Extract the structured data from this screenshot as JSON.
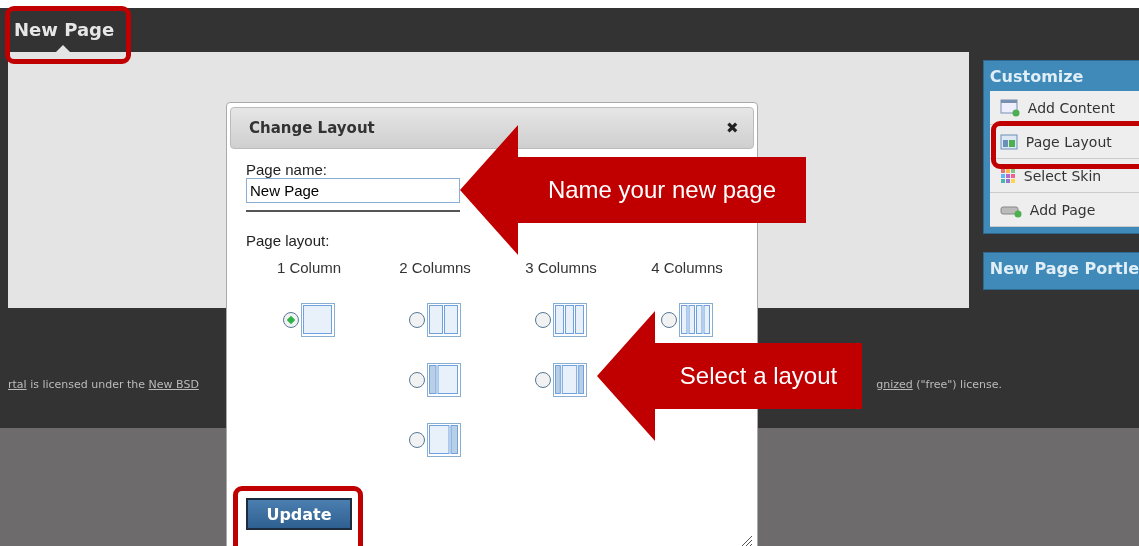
{
  "top_tab": {
    "label": "New Page",
    "selected": true
  },
  "dialog": {
    "title": "Change Layout",
    "close": "✖",
    "name_label": "Page name:",
    "name_value": "New Page",
    "layout_label": "Page layout:",
    "columns": [
      {
        "label": "1 Column",
        "options": [
          {
            "kind": "equal",
            "selected": true
          }
        ]
      },
      {
        "label": "2 Columns",
        "options": [
          {
            "kind": "equal",
            "selected": false
          },
          {
            "kind": "narrow-left",
            "selected": false
          },
          {
            "kind": "narrow-right",
            "selected": false
          }
        ]
      },
      {
        "label": "3 Columns",
        "options": [
          {
            "kind": "equal",
            "selected": false
          },
          {
            "kind": "wide-center",
            "selected": false
          }
        ]
      },
      {
        "label": "4 Columns",
        "options": [
          {
            "kind": "equal",
            "selected": false
          }
        ]
      }
    ],
    "button": "Update"
  },
  "customize": {
    "title": "Customize",
    "items": [
      {
        "label": "Add Content",
        "kind": "content"
      },
      {
        "label": "Page Layout",
        "kind": "layout"
      },
      {
        "label": "Select Skin",
        "kind": "skin"
      },
      {
        "label": "Add Page",
        "kind": "page"
      }
    ]
  },
  "portlet_panel": {
    "title": "New Page Portle"
  },
  "footer": {
    "left": [
      {
        "text": "rtal",
        "link": true
      },
      {
        "text": " is licensed under the ",
        "link": false
      },
      {
        "text": "New BSD",
        "link": true
      }
    ],
    "right": [
      {
        "text": "gnized",
        "link": true
      },
      {
        "text": " (\"free\") license.",
        "link": false
      }
    ]
  },
  "callouts": [
    {
      "text": "Name your new page"
    },
    {
      "text": "Select a layout"
    }
  ]
}
